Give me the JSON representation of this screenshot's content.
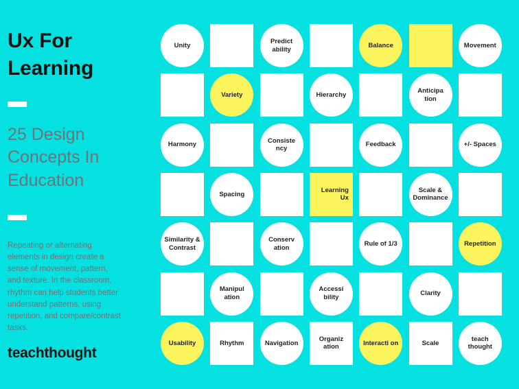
{
  "poster": {
    "background_color": "#05E0E0",
    "accent_yellow": "#FBF45C",
    "muted_text_color": "#6E747A",
    "dark_text_color": "#141414"
  },
  "left_panel": {
    "headline": "Ux For Learning",
    "subhead": "25 Design Concepts In Education",
    "body": "Repeating or alternating elements in design create a sense of movement, pattern, and texture. In the classroom, rhythm can help students better understand patterns, using repetition, and compare/contrast tasks.",
    "brand": "teachthought"
  },
  "grid": {
    "columns": 7,
    "rows": 7,
    "cells": [
      {
        "label": "Unity",
        "shape": "circle",
        "fill": "white",
        "align": "center"
      },
      {
        "label": "",
        "shape": "square",
        "fill": "white",
        "align": "center"
      },
      {
        "label": "Predict ability",
        "shape": "circle",
        "fill": "white",
        "align": "center"
      },
      {
        "label": "",
        "shape": "square",
        "fill": "white",
        "align": "center"
      },
      {
        "label": "Balance",
        "shape": "circle",
        "fill": "yellow",
        "align": "center"
      },
      {
        "label": "",
        "shape": "square",
        "fill": "yellow",
        "align": "center"
      },
      {
        "label": "Movement",
        "shape": "circle",
        "fill": "white",
        "align": "center"
      },
      {
        "label": "",
        "shape": "square",
        "fill": "white",
        "align": "center"
      },
      {
        "label": "Variety",
        "shape": "circle",
        "fill": "yellow",
        "align": "center"
      },
      {
        "label": "",
        "shape": "square",
        "fill": "white",
        "align": "center"
      },
      {
        "label": "Hierarchy",
        "shape": "circle",
        "fill": "white",
        "align": "center"
      },
      {
        "label": "",
        "shape": "square",
        "fill": "white",
        "align": "center"
      },
      {
        "label": "Anticipa tion",
        "shape": "circle",
        "fill": "white",
        "align": "center"
      },
      {
        "label": "",
        "shape": "square",
        "fill": "white",
        "align": "center"
      },
      {
        "label": "Harmony",
        "shape": "circle",
        "fill": "white",
        "align": "center"
      },
      {
        "label": "",
        "shape": "square",
        "fill": "white",
        "align": "center"
      },
      {
        "label": "Consiste ncy",
        "shape": "circle",
        "fill": "white",
        "align": "center"
      },
      {
        "label": "",
        "shape": "square",
        "fill": "white",
        "align": "center"
      },
      {
        "label": "Feedback",
        "shape": "circle",
        "fill": "white",
        "align": "center"
      },
      {
        "label": "",
        "shape": "square",
        "fill": "white",
        "align": "center"
      },
      {
        "label": "+/- Spaces",
        "shape": "circle",
        "fill": "white",
        "align": "center"
      },
      {
        "label": "",
        "shape": "square",
        "fill": "white",
        "align": "center"
      },
      {
        "label": "Spacing",
        "shape": "circle",
        "fill": "white",
        "align": "center"
      },
      {
        "label": "",
        "shape": "square",
        "fill": "white",
        "align": "center"
      },
      {
        "label": "Learning Ux",
        "shape": "square",
        "fill": "yellow",
        "align": "right"
      },
      {
        "label": "",
        "shape": "square",
        "fill": "white",
        "align": "center"
      },
      {
        "label": "Scale & Dominance",
        "shape": "circle",
        "fill": "white",
        "align": "center"
      },
      {
        "label": "",
        "shape": "square",
        "fill": "white",
        "align": "center"
      },
      {
        "label": "Similarity & Contrast",
        "shape": "circle",
        "fill": "white",
        "align": "center"
      },
      {
        "label": "",
        "shape": "square",
        "fill": "white",
        "align": "center"
      },
      {
        "label": "Conserv ation",
        "shape": "circle",
        "fill": "white",
        "align": "center"
      },
      {
        "label": "",
        "shape": "square",
        "fill": "white",
        "align": "center"
      },
      {
        "label": "Rule of 1/3",
        "shape": "circle",
        "fill": "white",
        "align": "center"
      },
      {
        "label": "",
        "shape": "square",
        "fill": "white",
        "align": "center"
      },
      {
        "label": "Repetition",
        "shape": "circle",
        "fill": "yellow",
        "align": "center"
      },
      {
        "label": "",
        "shape": "square",
        "fill": "white",
        "align": "center"
      },
      {
        "label": "Manipul ation",
        "shape": "circle",
        "fill": "white",
        "align": "center"
      },
      {
        "label": "",
        "shape": "square",
        "fill": "white",
        "align": "center"
      },
      {
        "label": "Accessi bility",
        "shape": "circle",
        "fill": "white",
        "align": "center"
      },
      {
        "label": "",
        "shape": "square",
        "fill": "white",
        "align": "center"
      },
      {
        "label": "Clarity",
        "shape": "circle",
        "fill": "white",
        "align": "center"
      },
      {
        "label": "",
        "shape": "square",
        "fill": "white",
        "align": "center"
      },
      {
        "label": "Usability",
        "shape": "circle",
        "fill": "yellow",
        "align": "center"
      },
      {
        "label": "Rhythm",
        "shape": "square",
        "fill": "white",
        "align": "center"
      },
      {
        "label": "Navigation",
        "shape": "circle",
        "fill": "white",
        "align": "center"
      },
      {
        "label": "Organiz ation",
        "shape": "square",
        "fill": "white",
        "align": "center"
      },
      {
        "label": "Interacti on",
        "shape": "circle",
        "fill": "yellow",
        "align": "center"
      },
      {
        "label": "Scale",
        "shape": "square",
        "fill": "white",
        "align": "center"
      },
      {
        "label": "teach thought",
        "shape": "circle",
        "fill": "white",
        "align": "center"
      }
    ]
  }
}
